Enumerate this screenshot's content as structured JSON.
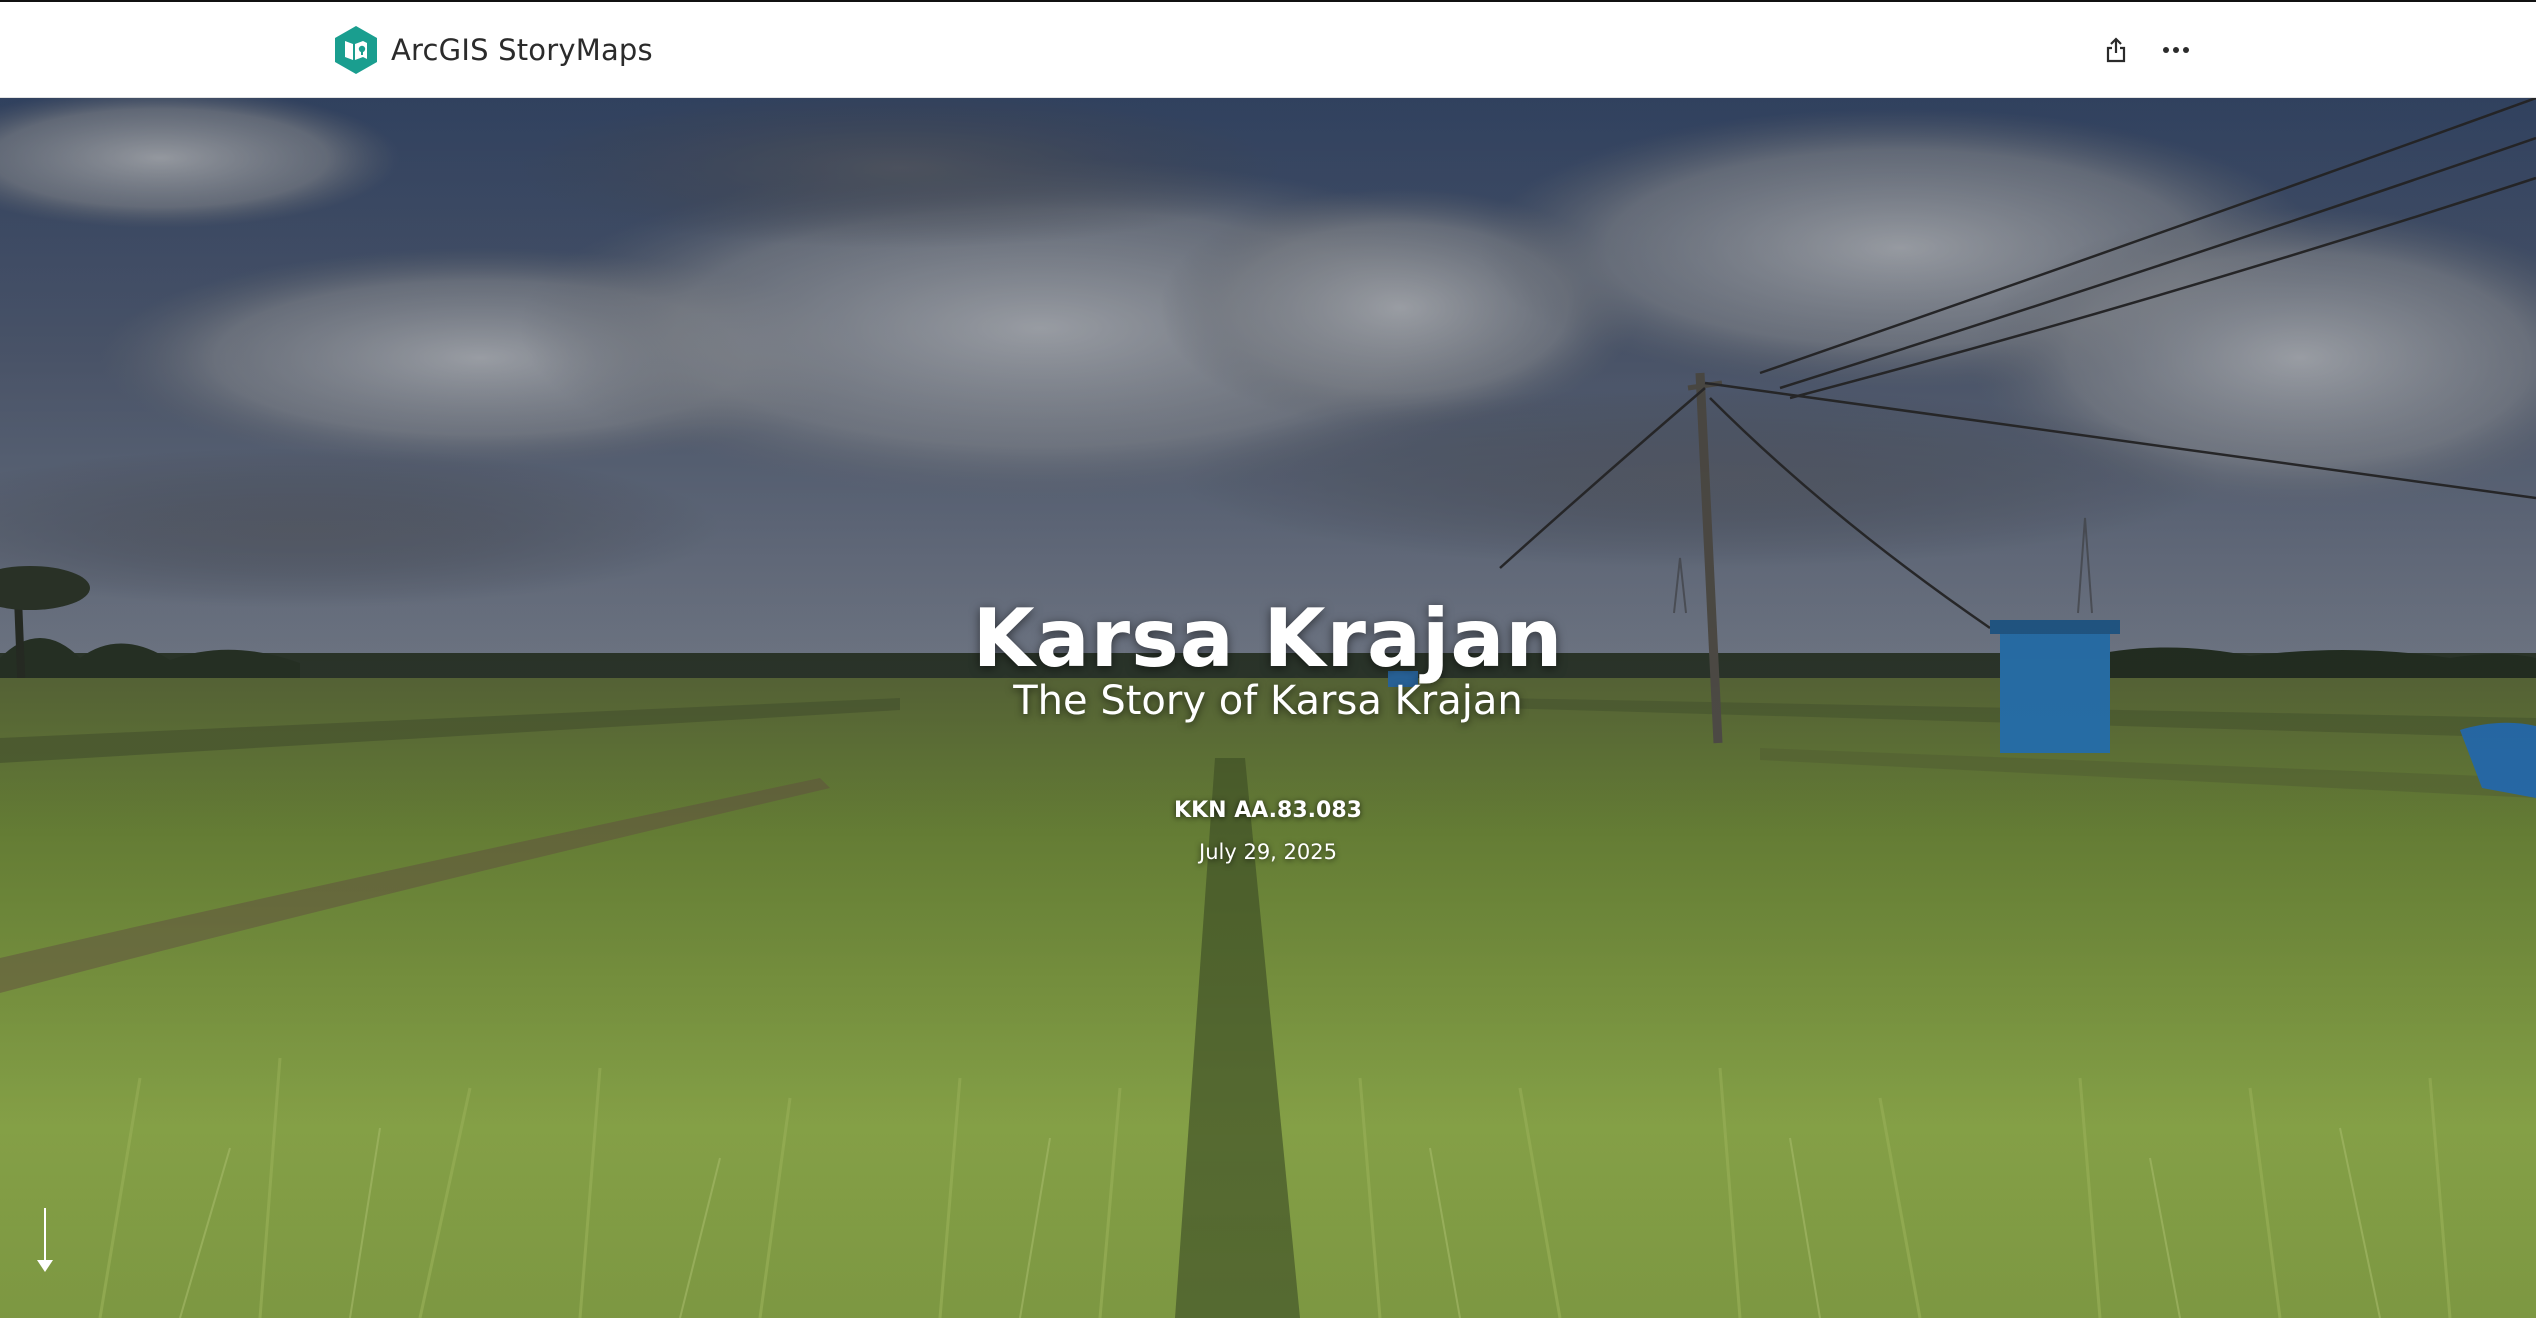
{
  "header": {
    "app_name": "ArcGIS StoryMaps",
    "logo_icon": "storymaps-logo-icon",
    "share_icon": "share-icon",
    "more_icon": "more-options-icon"
  },
  "story": {
    "title": "Karsa Krajan",
    "subtitle": "The Story of Karsa Krajan",
    "byline": "KKN AA.83.083",
    "date": "July 29, 2025"
  },
  "hero": {
    "scroll_icon": "arrow-down-icon"
  },
  "colors": {
    "brand_teal": "#1a9e8f",
    "header_bg": "#ffffff",
    "text_white": "#ffffff"
  }
}
